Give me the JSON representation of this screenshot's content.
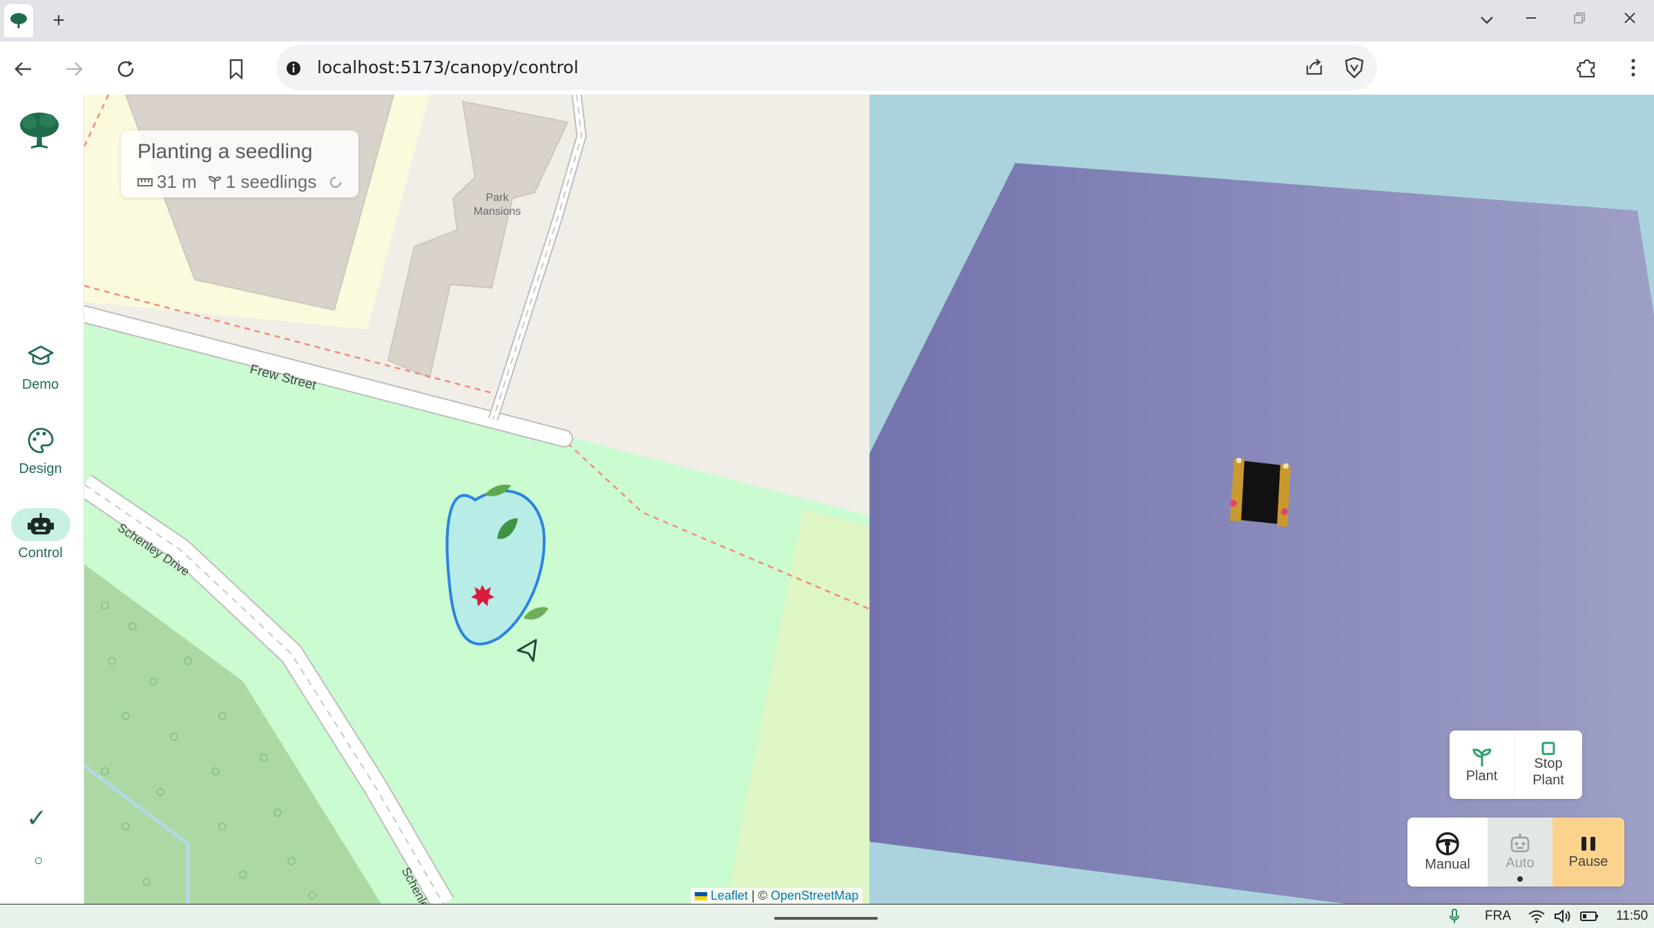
{
  "browser": {
    "tab_icon": "tree-icon",
    "new_tab": "+",
    "url": "localhost:5173/canopy/control"
  },
  "sidebar": {
    "items": [
      {
        "label": "Demo",
        "icon": "graduation-cap-icon"
      },
      {
        "label": "Design",
        "icon": "palette-icon"
      },
      {
        "label": "Control",
        "icon": "robot-icon",
        "active": true
      }
    ],
    "status_check": "✓",
    "status_circle": "○"
  },
  "map": {
    "info_card": {
      "title": "Planting a seedling",
      "distance": "31 m",
      "seedlings": "1 seedlings"
    },
    "labels": {
      "building": [
        "Park",
        "Mansions"
      ],
      "street1": "Frew Street",
      "street2": "Schenley Drive",
      "street3": "Schenle"
    },
    "attribution": {
      "leaflet": "Leaflet",
      "separator": " | © ",
      "osm": "OpenStreetMap"
    }
  },
  "controls": {
    "plant": "Plant",
    "stop_plant_1": "Stop",
    "stop_plant_2": "Plant",
    "manual": "Manual",
    "auto": "Auto",
    "pause": "Pause"
  },
  "taskbar": {
    "language": "FRA",
    "time": "11:50"
  },
  "colors": {
    "accent": "#23695a",
    "active_bg": "#c8efe4",
    "pause_bg": "#fbd38d",
    "auto_bg": "#e2e6e4"
  }
}
